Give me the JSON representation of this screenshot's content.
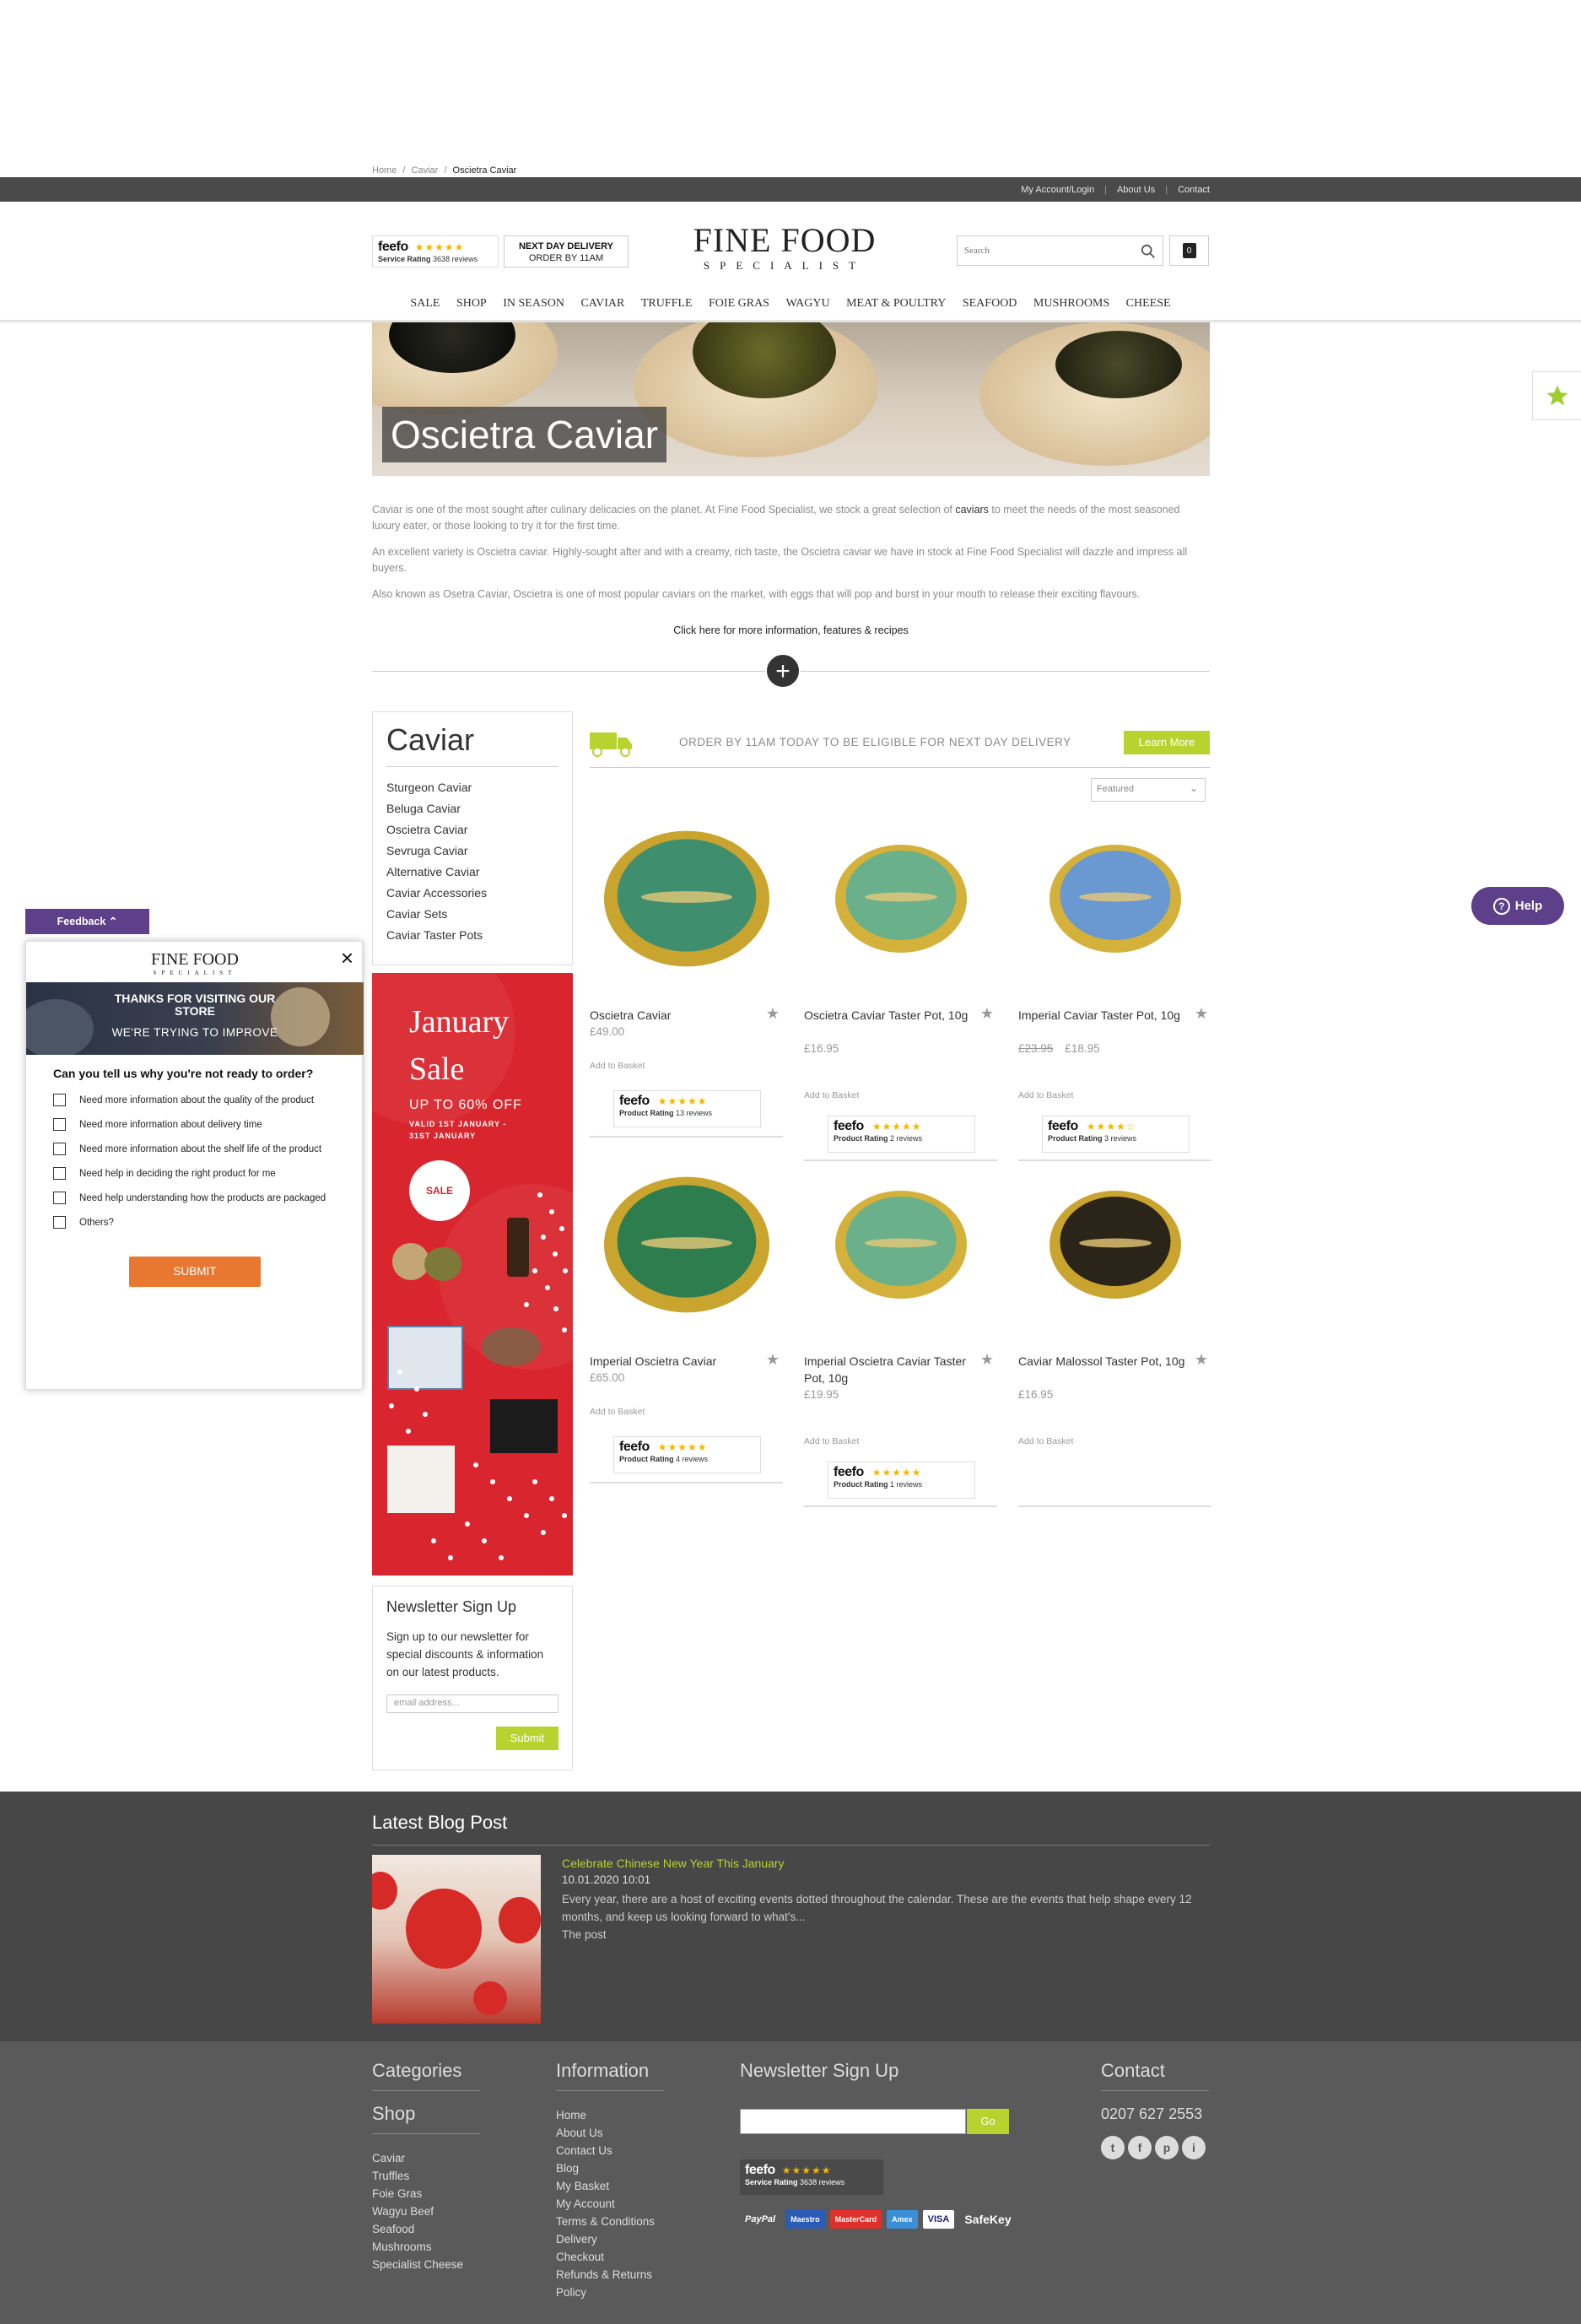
{
  "breadcrumb": {
    "home": "Home",
    "sep1": "/",
    "caviar": "Caviar",
    "sep2": "/",
    "current": "Oscietra Caviar"
  },
  "topbar": {
    "account": "My Account/Login",
    "sep1": "|",
    "about": "About Us",
    "sep2": "|",
    "contact": "Contact"
  },
  "header": {
    "feefo": {
      "logo": "feefo",
      "stars": "★★★★★",
      "label": "Service Rating",
      "reviews": "3638 reviews"
    },
    "delivery": {
      "line1": "NEXT DAY DELIVERY",
      "line2": "ORDER BY 11AM"
    },
    "brand_line1": "FINE FOOD",
    "brand_line2": "SPECIALIST",
    "search_placeholder": "Search",
    "basket_count": "0"
  },
  "nav": [
    "SALE",
    "SHOP",
    "IN SEASON",
    "CAVIAR",
    "TRUFFLE",
    "FOIE GRAS",
    "WAGYU",
    "MEAT & POULTRY",
    "SEAFOOD",
    "MUSHROOMS",
    "CHEESE"
  ],
  "hero_title": "Oscietra Caviar",
  "intro": {
    "p1_a": "Caviar is one of the most sought after culinary delicacies on the planet. At Fine Food Specialist, we stock a great selection of ",
    "p1_link": "caviars",
    "p1_b": " to meet the needs of the most seasoned luxury eater, or those looking to try it for the first time.",
    "p2": " An excellent variety is Oscietra caviar. Highly-sought after and with a creamy, rich taste, the Oscietra caviar we have in stock at Fine Food Specialist will dazzle and impress all buyers.",
    "p3": " Also known as Osetra Caviar, Oscietra is one of most popular caviars on the market, with eggs that will pop and burst in your mouth to release their exciting flavours.",
    "more": "Click here for more information, features & recipes"
  },
  "sidebar": {
    "title": "Caviar",
    "items": [
      "Sturgeon Caviar",
      "Beluga Caviar",
      "Oscietra Caviar",
      "Sevruga Caviar",
      "Alternative Caviar",
      "Caviar Accessories",
      "Caviar Sets",
      "Caviar Taster Pots"
    ],
    "promo": {
      "title1": "January",
      "title2": "Sale",
      "off": "UP TO 60% OFF",
      "valid1": "VALID 1ST JANUARY -",
      "valid2": "31ST JANUARY",
      "badge": "SALE"
    },
    "newsletter": {
      "title": "Newsletter Sign Up",
      "text": "Sign up to our newsletter for special discounts & information on our latest products.",
      "placeholder": "email address...",
      "submit": "Submit"
    }
  },
  "delivery_bar": {
    "text": "ORDER BY 11AM TODAY TO BE ELIGIBLE FOR NEXT DAY DELIVERY",
    "button": "Learn More"
  },
  "sort": {
    "selected": "Featured"
  },
  "products": [
    {
      "name": "Oscietra Caviar",
      "price": "£49.00",
      "old_price": "",
      "add": "Add to Basket",
      "rating_label": "Product Rating",
      "reviews": "13 reviews",
      "stars": "★★★★★",
      "lid": "#3f8f6f",
      "ring": "#c9a42e"
    },
    {
      "name": "Oscietra Caviar Taster Pot, 10g",
      "price": "£16.95",
      "old_price": "",
      "add": "Add to Basket",
      "rating_label": "Product Rating",
      "reviews": "2 reviews",
      "stars": "★★★★★",
      "lid": "#6ab08a",
      "ring": "#d3b13b"
    },
    {
      "name": "Imperial Caviar Taster Pot, 10g",
      "price": "£18.95",
      "old_price": "£23.95",
      "add": "Add to Basket",
      "rating_label": "Product Rating",
      "reviews": "3 reviews",
      "stars": "★★★★☆",
      "lid": "#6a98d0",
      "ring": "#d3b13b"
    },
    {
      "name": "Imperial Oscietra Caviar",
      "price": "£65.00",
      "old_price": "",
      "add": "Add to Basket",
      "rating_label": "Product Rating",
      "reviews": "4 reviews",
      "stars": "★★★★★",
      "lid": "#2e7d4f",
      "ring": "#c9a42e"
    },
    {
      "name": "Imperial Oscietra Caviar Taster Pot, 10g",
      "price": "£19.95",
      "old_price": "",
      "add": "Add to Basket",
      "rating_label": "Product Rating",
      "reviews": "1 reviews",
      "stars": "★★★★★",
      "lid": "#6ab08a",
      "ring": "#d3b13b"
    },
    {
      "name": "Caviar Malossol Taster Pot, 10g",
      "price": "£16.95",
      "old_price": "",
      "add": "Add to Basket",
      "rating_label": "",
      "reviews": "",
      "stars": "",
      "lid": "#2b2418",
      "ring": "#c9a42e"
    }
  ],
  "feedback": {
    "tab": "Feedback",
    "brand1": "FINE FOOD",
    "brand2": "SPECIALIST",
    "banner1": "THANKS FOR VISITING OUR STORE",
    "banner2": "WE'RE TRYING TO IMPROVE",
    "question": "Can you tell us why you're not ready to order?",
    "options": [
      "Need more information about the quality of the product",
      "Need more information about delivery time",
      "Need more information about the shelf life of the product",
      "Need help in deciding the right product for me",
      "Need help understanding how the products are packaged",
      "Others?"
    ],
    "submit": "SUBMIT"
  },
  "help": "Help",
  "blog": {
    "heading": "Latest Blog Post",
    "title": "Celebrate Chinese New Year This January",
    "date": "10.01.2020 10:01",
    "excerpt": "Every year, there are a host of exciting events dotted throughout the calendar. These are the events that help shape every 12 months, and keep us looking forward to what's...",
    "more": "The post"
  },
  "footer": {
    "categories": "Categories",
    "shop": "Shop",
    "shop_items": [
      "Caviar",
      "Truffles",
      "Foie Gras",
      "Wagyu Beef",
      "Seafood",
      "Mushrooms",
      "Specialist Cheese"
    ],
    "information": "Information",
    "info_items": [
      "Home",
      "About Us",
      "Contact Us",
      "Blog",
      "My Basket",
      "My Account",
      "Terms & Conditions",
      "Delivery",
      "Checkout",
      "Refunds & Returns",
      "Policy"
    ],
    "newsletter": "Newsletter Sign Up",
    "go": "Go",
    "feefo": {
      "logo": "feefo",
      "stars": "★★★★★",
      "label": "Service Rating",
      "reviews": "3638 reviews"
    },
    "payments": [
      "PayPal",
      "Maestro",
      "MasterCard",
      "Amex",
      "VISA",
      "SafeKey"
    ],
    "contact": "Contact",
    "phone": "0207 627 2553",
    "social": [
      "t",
      "f",
      "p",
      "i"
    ]
  },
  "colors": {
    "accent": "#b8d32f",
    "dark": "#4a4a4a",
    "feedback_purple": "#5d3f8a",
    "promo_red": "#d9262e",
    "submit_orange": "#e87830"
  }
}
